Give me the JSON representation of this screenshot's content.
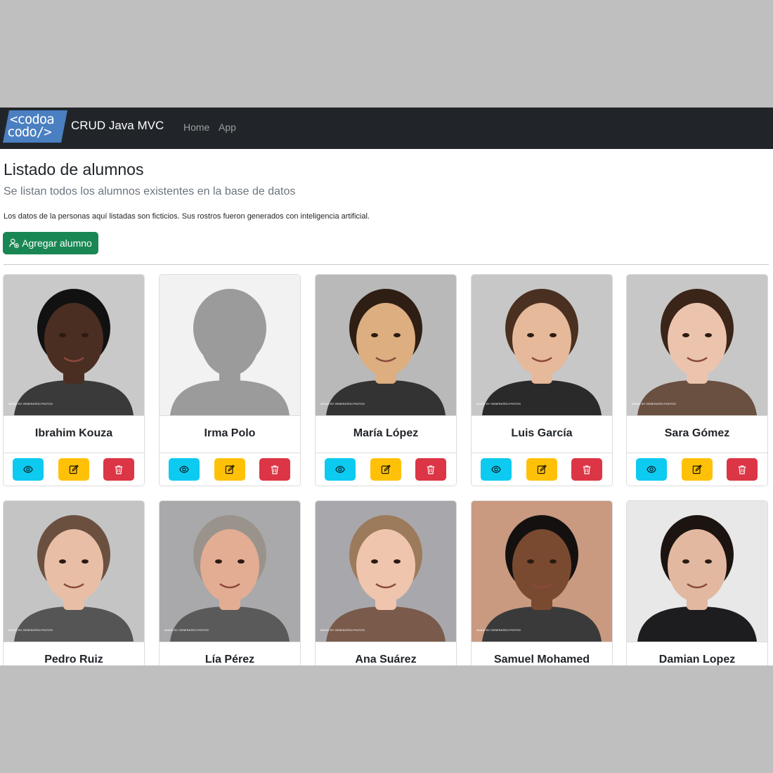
{
  "navbar": {
    "logo_line1": "<codoa",
    "logo_line2": "codo/>",
    "brand": "CRUD Java MVC",
    "links": [
      {
        "label": "Home"
      },
      {
        "label": "App"
      }
    ],
    "colors": {
      "background": "#212529",
      "logo": "#4a7fc1"
    }
  },
  "header": {
    "title": "Listado de alumnos",
    "lead": "Se listan todos los alumnos existentes en la base de datos",
    "disclaimer": "Los datos de la personas aquí listadas son ficticios. Sus rostros fueron generados con inteligencia artificial.",
    "add_button": {
      "label": "Agregar alumno",
      "icon": "person-add-icon",
      "color": "#198754"
    }
  },
  "card_actions": {
    "view": {
      "icon": "eye-icon",
      "color": "#0dcaf0"
    },
    "edit": {
      "icon": "pencil-square-icon",
      "color": "#ffc107"
    },
    "delete": {
      "icon": "trash-icon",
      "color": "#dc3545"
    }
  },
  "students": [
    {
      "name": "Ibrahim Kouza",
      "photo": "portrait-photo",
      "watermark": "IMAGE BY GENERATED.PHOTOS",
      "bg": "#c9c9c9",
      "skin": "#4a2e22",
      "hair": "#111111",
      "shirt": "#3a3a3a"
    },
    {
      "name": "Irma Polo",
      "photo": "placeholder-silhouette",
      "watermark": "",
      "bg": "#f2f2f2",
      "skin": "#9b9b9b",
      "hair": "#9b9b9b",
      "shirt": "#9b9b9b"
    },
    {
      "name": "María López",
      "photo": "portrait-photo",
      "watermark": "IMAGE BY GENERATED.PHOTOS",
      "bg": "#b9b9b9",
      "skin": "#dcae80",
      "hair": "#2e1e14",
      "shirt": "#333333"
    },
    {
      "name": "Luis García",
      "photo": "portrait-photo",
      "watermark": "IMAGE BY GENERATED.PHOTOS",
      "bg": "#c7c7c7",
      "skin": "#e6b99a",
      "hair": "#4a3020",
      "shirt": "#2a2a2a"
    },
    {
      "name": "Sara Gómez",
      "photo": "portrait-photo",
      "watermark": "IMAGE BY GENERATED.PHOTOS",
      "bg": "#c7c7c7",
      "skin": "#ecc4ae",
      "hair": "#3a2518",
      "shirt": "#6a5040"
    },
    {
      "name": "Pedro Ruiz",
      "photo": "portrait-photo",
      "watermark": "IMAGE BY GENERATED.PHOTOS",
      "bg": "#c4c4c4",
      "skin": "#e8bfa6",
      "hair": "#6b5040",
      "shirt": "#555555"
    },
    {
      "name": "Lía Pérez",
      "photo": "portrait-photo",
      "watermark": "IMAGE BY GENERATED.PHOTOS",
      "bg": "#a9a9ab",
      "skin": "#e3ad93",
      "hair": "#9a938c",
      "shirt": "#5a5a5a"
    },
    {
      "name": "Ana Suárez",
      "photo": "portrait-photo",
      "watermark": "IMAGE BY GENERATED.PHOTOS",
      "bg": "#a8a8ac",
      "skin": "#efc5ae",
      "hair": "#9c7a5c",
      "shirt": "#7a5a4a"
    },
    {
      "name": "Samuel Mohamed",
      "photo": "portrait-photo",
      "watermark": "IMAGE BY GENERATED.PHOTOS",
      "bg": "#c99a80",
      "skin": "#7a4a30",
      "hair": "#141010",
      "shirt": "#3a3a3a"
    },
    {
      "name": "Damian Lopez",
      "photo": "portrait-photo",
      "watermark": "",
      "bg": "#e8e8e8",
      "skin": "#e2b8a0",
      "hair": "#1c1410",
      "shirt": "#1d1d20"
    }
  ]
}
